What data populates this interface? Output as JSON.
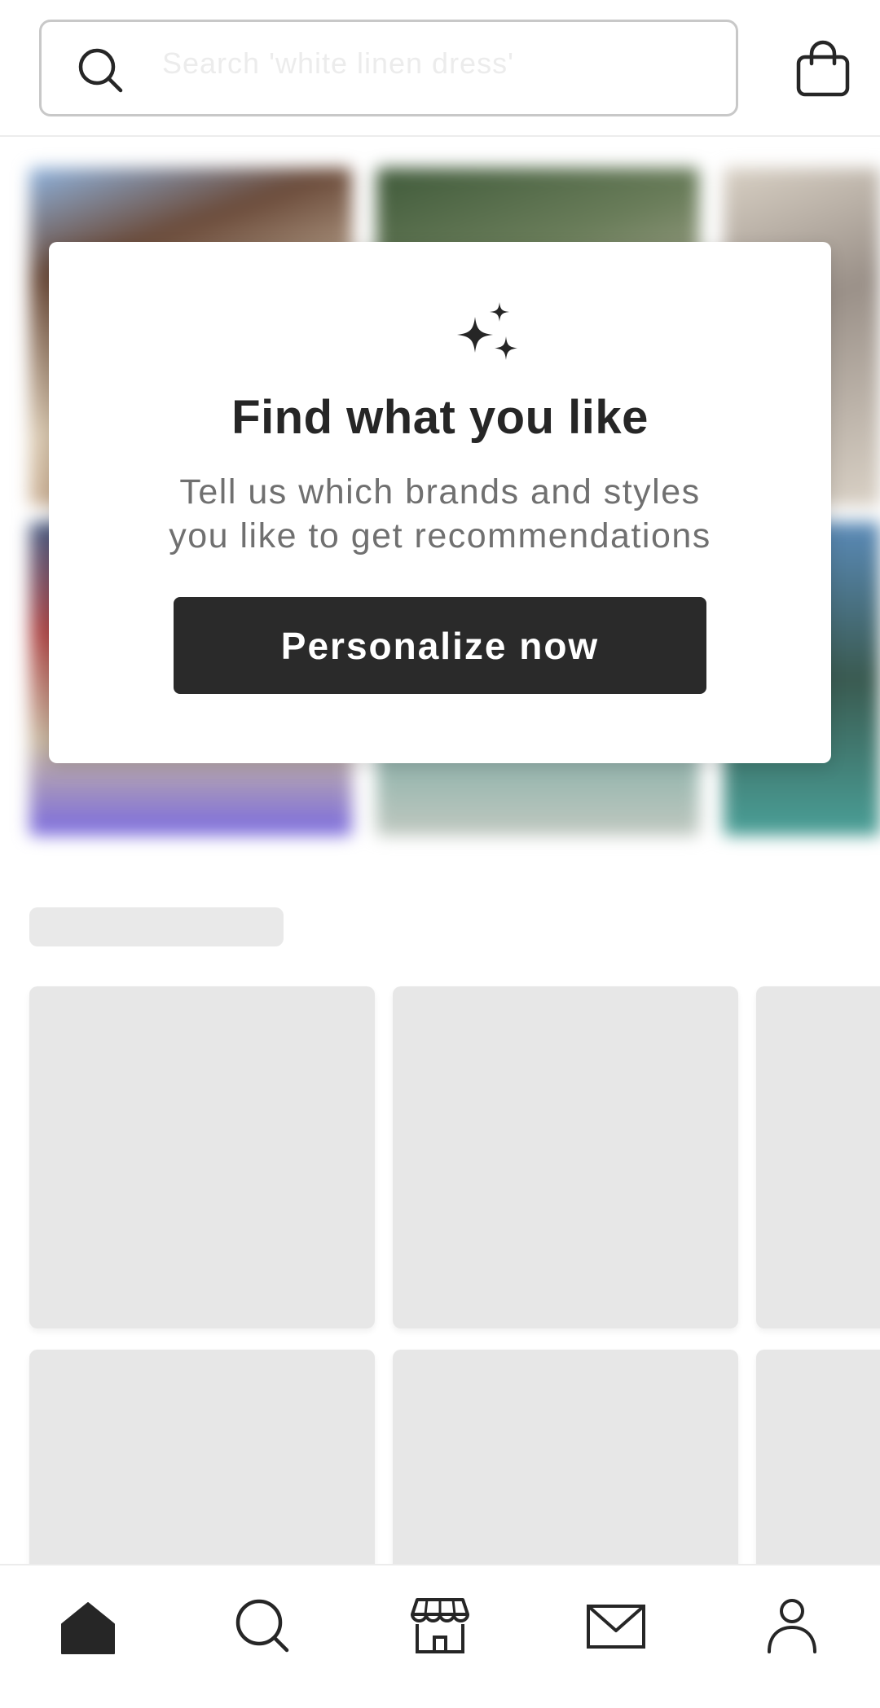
{
  "header": {
    "search_placeholder": "Search 'white linen dress'",
    "search_icon": "search-icon",
    "bag_icon": "shopping-bag-icon"
  },
  "promo": {
    "icon": "sparkles-icon",
    "title": "Find what you like",
    "description": "Tell us which brands and styles you like to get recommendations",
    "cta_label": "Personalize now"
  },
  "bottom_nav": {
    "items": [
      {
        "icon": "home-icon",
        "active": true
      },
      {
        "icon": "search-icon",
        "active": false
      },
      {
        "icon": "store-icon",
        "active": false
      },
      {
        "icon": "mail-icon",
        "active": false
      },
      {
        "icon": "profile-icon",
        "active": false
      }
    ]
  },
  "colors": {
    "primary": "#262626",
    "muted_text": "#707070",
    "skeleton": "#e7e7e7",
    "background": "#ffffff"
  }
}
